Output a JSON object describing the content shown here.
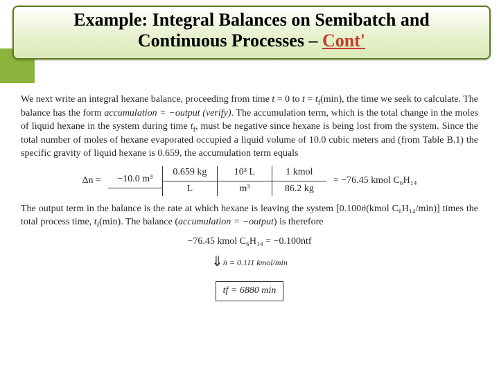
{
  "title": {
    "line1": "Example: Integral Balances on Semibatch and",
    "line2_prefix": "Continuous Processes – ",
    "cont": "Cont'"
  },
  "para1": {
    "t1": "We next write an integral hexane balance, proceeding from time ",
    "t2": "t",
    "t3": " = 0 to ",
    "t4": "t",
    "t5": " = ",
    "t6": "t",
    "t7": "f",
    "t8": "(min), the time we seek to calculate. The balance has the form ",
    "t9": "accumulation = −output",
    "t10": "(verify)",
    "t11": ". The accumulation term, which is the total change in the moles of liquid hexane in the system during time ",
    "t12": "t",
    "t13": "f",
    "t14": ", must be negative since hexane is being lost from the system. Since the total number of moles of hexane evaporated occupied a liquid volume of 10.0 cubic meters and (from Table B.1) the specific gravity of liquid hexane is 0.659, the accumulation term equals"
  },
  "calc": {
    "deltaN": "Δn = ",
    "f1_num": "−10.0 m³",
    "f1_den": "",
    "f2_num": "0.659 kg",
    "f2_den": "L",
    "f3_num": "10³ L",
    "f3_den": "m³",
    "f4_num": "1 kmol",
    "f4_den": "86.2 kg",
    "result": " = −76.45 kmol C₆H₁₄"
  },
  "para2": {
    "t1": "The output term in the balance is the rate at which hexane is leaving the system [0.100",
    "t2": "ṅ",
    "t3": "(kmol C₆H₁₄/min)] times the total process time, ",
    "t4": "t",
    "t5": "f",
    "t6": "(min). The balance (",
    "t7": "accumulation = −output",
    "t8": ") is therefore"
  },
  "eq1": "−76.45 kmol C₆H₁₄ = −0.100ṅtf",
  "ndot_note": "ṅ = 0.111 kmol/min",
  "result_box": "tf = 6880 min"
}
